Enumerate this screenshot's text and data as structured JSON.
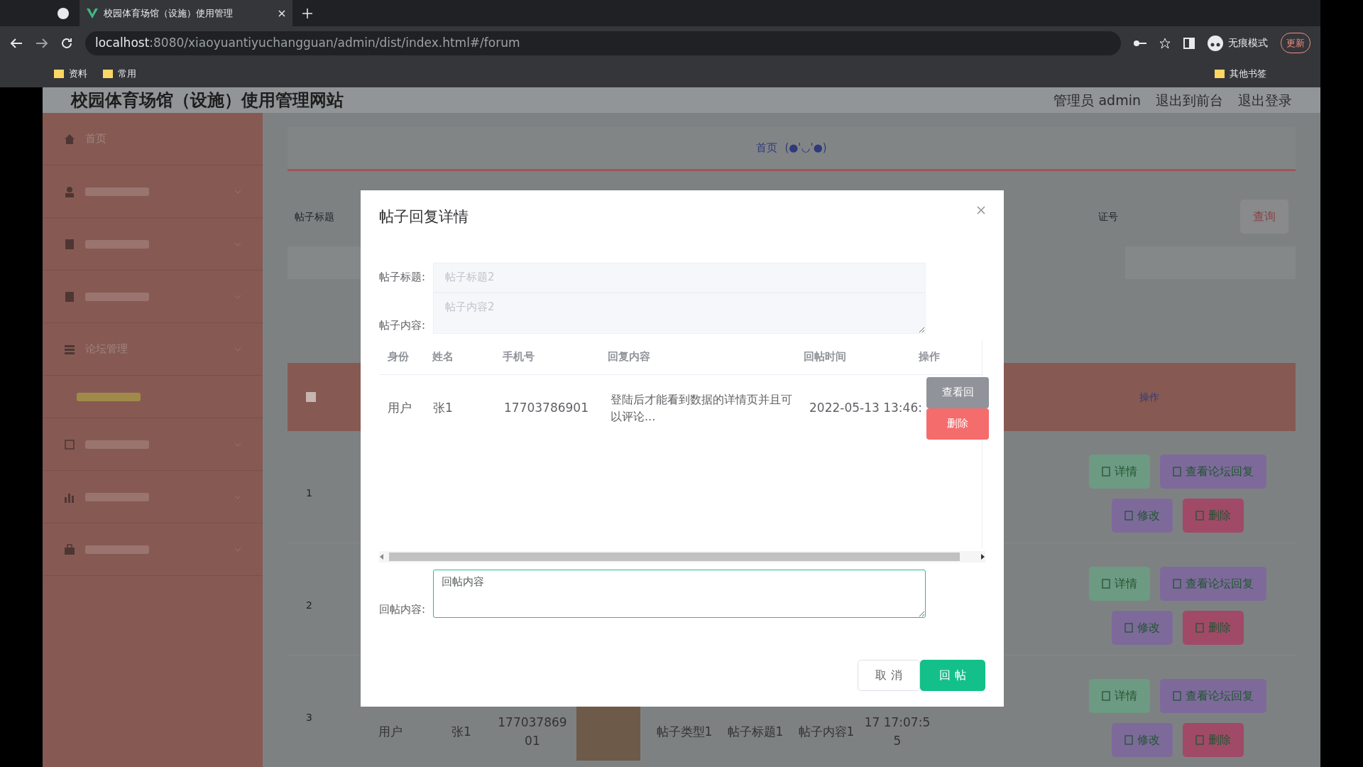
{
  "browser": {
    "tab_title": "校园体育场馆（设施）使用管理",
    "url_host": "localhost",
    "url_rest": ":8080/xiaoyuantiyuchangguan/admin/dist/index.html#/forum",
    "incognito": "无痕模式",
    "update": "更新",
    "bookmarks": [
      "资料",
      "常用"
    ],
    "other_bookmarks": "其他书签"
  },
  "header": {
    "title": "校园体育场馆（设施）使用管理网站",
    "links": [
      "管理员 admin",
      "退出到前台",
      "退出登录"
    ]
  },
  "sidebar": {
    "items": [
      {
        "kind": "menu",
        "label": "首页",
        "expandable": false
      },
      {
        "kind": "menu",
        "expandable": true
      },
      {
        "kind": "menu",
        "expandable": true
      },
      {
        "kind": "menu",
        "expandable": true
      },
      {
        "kind": "menu",
        "expandable": true,
        "label": "论坛管理"
      },
      {
        "kind": "submenu"
      },
      {
        "kind": "menu",
        "expandable": true
      },
      {
        "kind": "menu",
        "expandable": true
      },
      {
        "kind": "menu",
        "expandable": true
      }
    ]
  },
  "breadcrumb": {
    "items": [
      "首页",
      "(●'◡'●)"
    ]
  },
  "search": {
    "label_1": "帖子标题",
    "label_2": "证号",
    "button": "查询"
  },
  "bg_table": {
    "action_header": "操作",
    "select_all_checked": false,
    "rows": [
      {
        "index": "1",
        "cells": [],
        "actions": [
          "详情",
          "查看论坛回复",
          "修改",
          "删除"
        ]
      },
      {
        "index": "2",
        "cells": [],
        "actions": [
          "详情",
          "查看论坛回复",
          "修改",
          "删除"
        ]
      },
      {
        "index": "3",
        "cells": [
          "用户",
          "张1",
          "17703786901",
          "",
          "帖子类型1",
          "帖子标题1",
          "帖子内容1",
          "17 17:07:55"
        ],
        "actions": [
          "详情",
          "查看论坛回复",
          "修改",
          "删除"
        ]
      }
    ]
  },
  "modal": {
    "title": "帖子回复详情",
    "fields": [
      {
        "label": "帖子标题:",
        "value": "帖子标题2",
        "kind": "input"
      },
      {
        "label": "帖子内容:",
        "value": "帖子内容2",
        "kind": "textarea"
      }
    ],
    "table": {
      "columns": [
        "身份",
        "姓名",
        "手机号",
        "回复内容",
        "回帖时间",
        "操作"
      ],
      "rows": [
        {
          "cells": [
            "用户",
            "张1",
            "17703786901",
            "登陆后才能看到数据的详情页并且可以评论...",
            "2022-05-13 13:46:"
          ],
          "actions": [
            "查看回",
            "删除"
          ]
        }
      ]
    },
    "reply": {
      "label": "回帖内容:",
      "placeholder": "回帖内容"
    },
    "buttons": [
      "取 消",
      "回 帖"
    ]
  }
}
